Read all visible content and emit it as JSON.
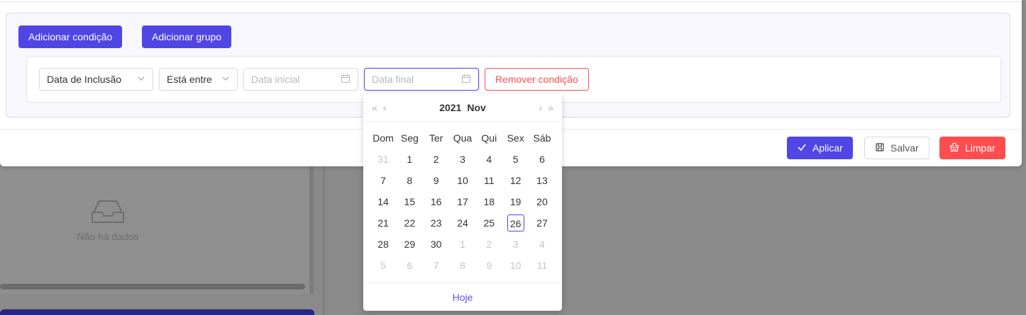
{
  "background": {
    "empty_text": "Não há dados"
  },
  "toolbar": {
    "add_condition_label": "Adicionar condição",
    "add_group_label": "Adicionar grupo"
  },
  "condition": {
    "field_value": "Data de Inclusão",
    "operator_value": "Está entre",
    "start_placeholder": "Data inicial",
    "end_placeholder": "Data final",
    "remove_label": "Remover condição"
  },
  "footer": {
    "apply_label": "Aplicar",
    "save_label": "Salvar",
    "clear_label": "Limpar"
  },
  "calendar": {
    "year": "2021",
    "month": "Nov",
    "weekdays": [
      "Dom",
      "Seg",
      "Ter",
      "Qua",
      "Qui",
      "Sex",
      "Sáb"
    ],
    "weeks": [
      [
        {
          "d": "31",
          "out": true
        },
        {
          "d": "1"
        },
        {
          "d": "2"
        },
        {
          "d": "3"
        },
        {
          "d": "4"
        },
        {
          "d": "5"
        },
        {
          "d": "6"
        }
      ],
      [
        {
          "d": "7"
        },
        {
          "d": "8"
        },
        {
          "d": "9"
        },
        {
          "d": "10"
        },
        {
          "d": "11"
        },
        {
          "d": "12"
        },
        {
          "d": "13"
        }
      ],
      [
        {
          "d": "14"
        },
        {
          "d": "15"
        },
        {
          "d": "16"
        },
        {
          "d": "17"
        },
        {
          "d": "18"
        },
        {
          "d": "19"
        },
        {
          "d": "20"
        }
      ],
      [
        {
          "d": "21"
        },
        {
          "d": "22"
        },
        {
          "d": "23"
        },
        {
          "d": "24"
        },
        {
          "d": "25"
        },
        {
          "d": "26",
          "today": true
        },
        {
          "d": "27"
        }
      ],
      [
        {
          "d": "28"
        },
        {
          "d": "29"
        },
        {
          "d": "30"
        },
        {
          "d": "1",
          "out": true
        },
        {
          "d": "2",
          "out": true
        },
        {
          "d": "3",
          "out": true
        },
        {
          "d": "4",
          "out": true
        }
      ],
      [
        {
          "d": "5",
          "out": true
        },
        {
          "d": "6",
          "out": true
        },
        {
          "d": "7",
          "out": true
        },
        {
          "d": "8",
          "out": true
        },
        {
          "d": "9",
          "out": true
        },
        {
          "d": "10",
          "out": true
        },
        {
          "d": "11",
          "out": true
        }
      ]
    ],
    "today_label": "Hoje"
  },
  "colors": {
    "primary": "#4f46e5",
    "danger": "#ff4d4f"
  }
}
